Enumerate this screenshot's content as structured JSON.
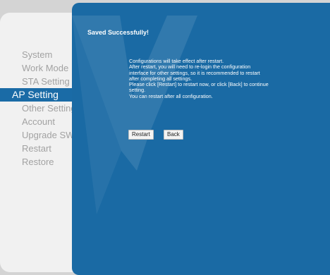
{
  "sidebar": {
    "items": [
      {
        "label": "System"
      },
      {
        "label": "Work Mode"
      },
      {
        "label": "STA Setting"
      },
      {
        "label": "AP Setting"
      },
      {
        "label": "Other Setting"
      },
      {
        "label": "Account"
      },
      {
        "label": "Upgrade SW"
      },
      {
        "label": "Restart"
      },
      {
        "label": "Restore"
      }
    ],
    "active_index": 3
  },
  "main": {
    "status_title": "Saved Successfully!",
    "message_lines": [
      "Configurations will take effect after restart.",
      "After restart, you will need to re-login the configuration",
      "interface for other settings, so it is recommended to restart",
      "after completing all settings.",
      "Please click [Restart] to restart now, or click [Back] to continue",
      "setting.",
      "You can restart after all configuration."
    ],
    "restart_button": "Restart",
    "back_button": "Back"
  },
  "colors": {
    "panel": "#1a6aa4",
    "active_item": "#1a6ba6",
    "sidebar": "#f1f1f1"
  }
}
